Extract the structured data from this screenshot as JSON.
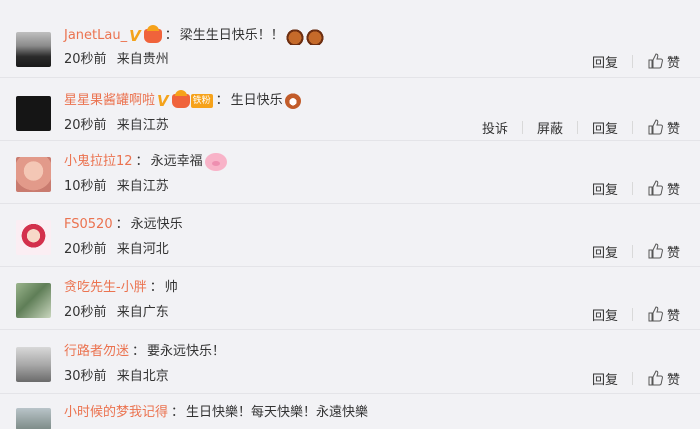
{
  "icons": {
    "like": "thumbs-up-icon",
    "vip": "v-badge-icon",
    "crown": "crown-badge-icon"
  },
  "colors": {
    "username": "#eb7350",
    "background": "#f2f2f5",
    "badge": "#f4a31b"
  },
  "comments": [
    {
      "name": "JanetLau_",
      "sep": "：",
      "text": "梁生生日快乐！！",
      "time": "20秒前",
      "from": "来自贵州",
      "reply": "回复",
      "like": "赞"
    },
    {
      "name": "星星果酱罐啊啦",
      "fan": "铁粉",
      "sep": "：",
      "text": "生日快乐",
      "time": "20秒前",
      "from": "来自江苏",
      "report": "投诉",
      "block": "屏蔽",
      "reply": "回复",
      "like": "赞"
    },
    {
      "name": "小鬼拉拉12",
      "sep": "：",
      "text": "永远幸福",
      "time": "10秒前",
      "from": "来自江苏",
      "reply": "回复",
      "like": "赞"
    },
    {
      "name": "FS0520",
      "sep": "：",
      "text": "永远快乐",
      "time": "20秒前",
      "from": "来自河北",
      "reply": "回复",
      "like": "赞"
    },
    {
      "name": "贪吃先生-小胖",
      "sep": "：",
      "text": "帅",
      "time": "20秒前",
      "from": "来自广东",
      "reply": "回复",
      "like": "赞"
    },
    {
      "name": "行路者勿迷",
      "sep": "：",
      "text": "要永远快乐！",
      "time": "30秒前",
      "from": "来自北京",
      "reply": "回复",
      "like": "赞"
    },
    {
      "name": "小时候的梦我记得",
      "sep": "：",
      "text": "生日快樂！每天快樂！永遠快樂"
    }
  ]
}
